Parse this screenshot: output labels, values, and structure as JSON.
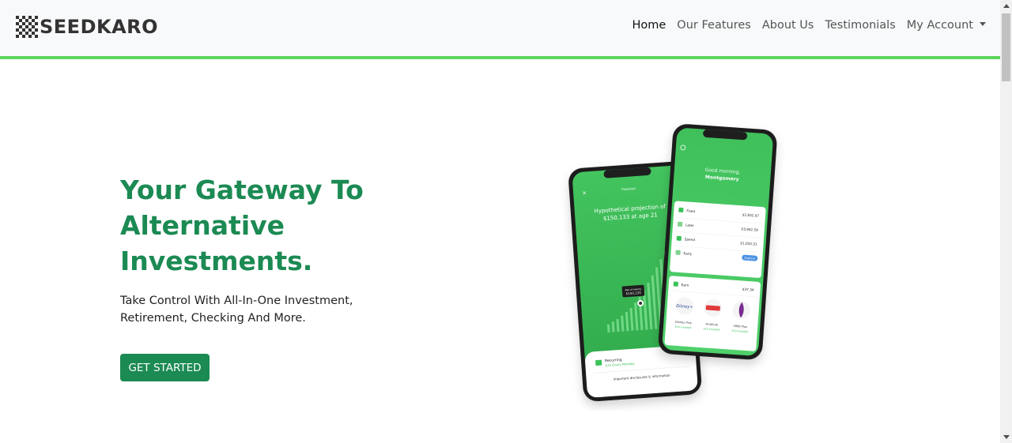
{
  "brand": {
    "name": "SEEDKARO",
    "logo_icon": "checker-logo-icon"
  },
  "nav": {
    "home": "Home",
    "features": "Our Features",
    "about": "About Us",
    "testimonials": "Testimonials",
    "account": "My Account"
  },
  "hero": {
    "title": "Your Gateway To Alternative Investments.",
    "subtitle": "Take Control With All-In-One Investment, Retirement, Checking And More.",
    "cta": "GET STARTED"
  },
  "phone_back": {
    "header": "Potential",
    "projection": "Hypothetical projection of",
    "amount": "$150,133 at age 21",
    "tooltip_top": "Age of twenty",
    "tooltip_value": "$150,133",
    "recurring_label": "Recurring",
    "recurring_value": "$25 Every Monday",
    "disclosures": "Important disclosures & information"
  },
  "phone_front": {
    "greeting": "Good morning,",
    "name": "Montgomery",
    "rows": [
      {
        "label": "Fixed",
        "value": "$2,832.97"
      },
      {
        "label": "Later",
        "value": "$3,942.59"
      },
      {
        "label": "Spend",
        "value": "$1,020.31"
      },
      {
        "label": "Early",
        "value": "Explore"
      }
    ],
    "earn_label": "Earn",
    "earn_value": "$37.34",
    "brands": [
      {
        "name": "Disney Plus",
        "amount": "$10 invested"
      },
      {
        "name": "Grubhub",
        "amount": "$10 invested"
      },
      {
        "name": "1800 Plus",
        "amount": "$10 invested"
      }
    ]
  },
  "colors": {
    "accent": "#1b8a53",
    "nav_border": "#5cd65c",
    "phone_green": "#3cc45a"
  }
}
